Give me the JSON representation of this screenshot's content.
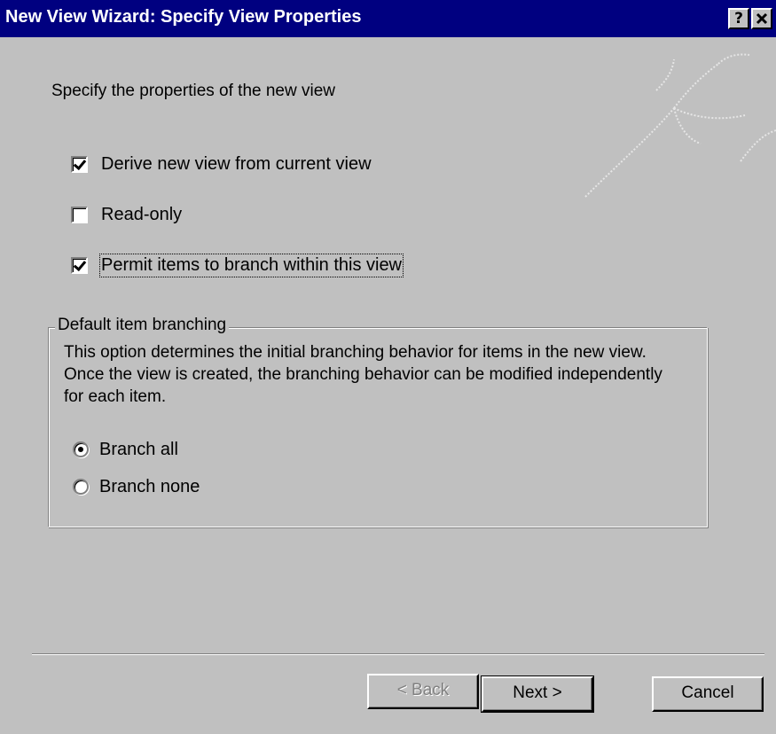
{
  "window": {
    "title": "New View Wizard: Specify View Properties",
    "help_button": "?",
    "close_button": "✕"
  },
  "prompt": "Specify the properties of the new view",
  "options": [
    {
      "label": "Derive new view from current view",
      "checked": true
    },
    {
      "label": "Read-only",
      "checked": false
    },
    {
      "label": "Permit items to branch within this view",
      "checked": true
    }
  ],
  "branching_group": {
    "legend": "Default item branching",
    "description": "This option determines the initial branching behavior for items in the new view. Once the view is created, the branching behavior can be modified independently for each item.",
    "radios": [
      {
        "label": "Branch all",
        "selected": true
      },
      {
        "label": "Branch none",
        "selected": false
      }
    ]
  },
  "buttons": {
    "back": "< Back",
    "next": "Next >",
    "cancel": "Cancel"
  }
}
